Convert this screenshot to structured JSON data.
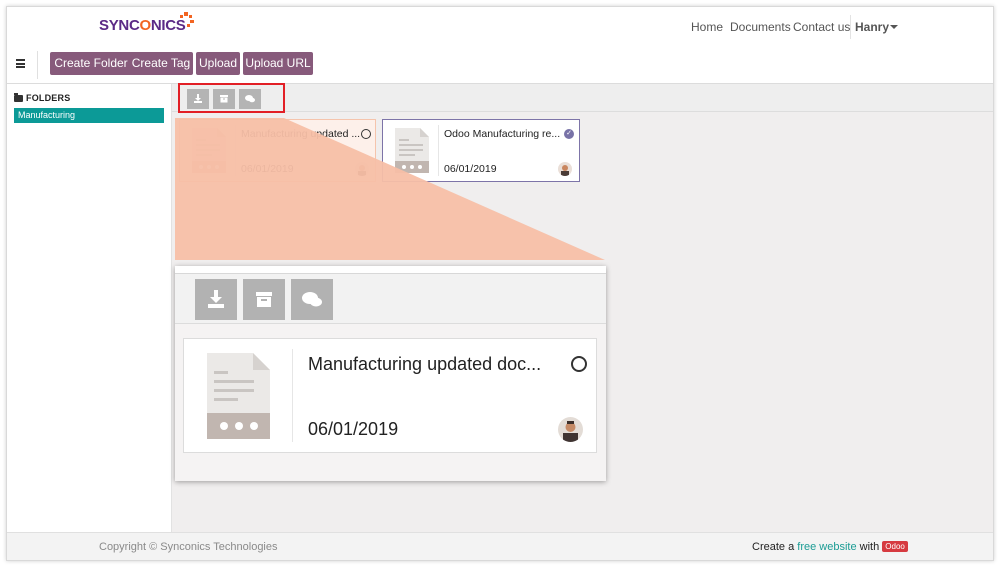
{
  "brand": {
    "name_part1": "SYNC",
    "name_o": "O",
    "name_part2": "NICS"
  },
  "nav": {
    "home": "Home",
    "documents": "Documents",
    "contact": "Contact us",
    "user": "Hanry"
  },
  "toolbar": {
    "create_folder": "Create Folder",
    "create_tag": "Create Tag",
    "upload": "Upload",
    "upload_url": "Upload URL"
  },
  "sidebar": {
    "title": "FOLDERS",
    "items": [
      {
        "label": "Manufacturing",
        "selected": true
      }
    ]
  },
  "document_actions": [
    "download-icon",
    "archive-icon",
    "comments-icon"
  ],
  "documents": [
    {
      "title": "Manufacturing updated ...",
      "date": "06/01/2019",
      "status": "unchecked",
      "selected": false
    },
    {
      "title": "Odoo Manufacturing re...",
      "date": "06/01/2019",
      "status": "checked",
      "selected": true
    }
  ],
  "zoom": {
    "title": "Manufacturing updated doc...",
    "date": "06/01/2019"
  },
  "footer": {
    "copyright": "Copyright © Synconics Technologies",
    "create_a": "Create a",
    "link": "free website",
    "with": "with",
    "badge": "Odoo"
  },
  "colors": {
    "brand_purple": "#875a7b",
    "teal": "#0c9a97",
    "highlight_red": "#e21f26",
    "zoom_beam": "#f7bfa7"
  }
}
